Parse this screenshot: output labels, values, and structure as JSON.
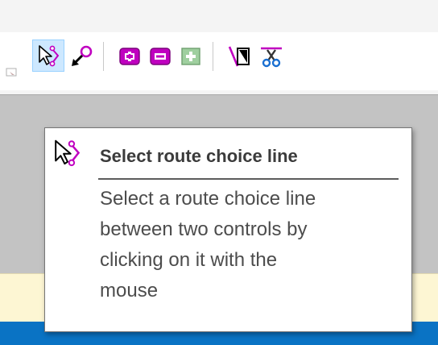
{
  "toolbar": {
    "buttons": [
      {
        "name": "select-route-choice-line",
        "icon": "select-route-choice-line-icon",
        "active": true
      },
      {
        "name": "move-control",
        "icon": "move-control-arrow-icon",
        "active": false
      },
      {
        "name": "add-control",
        "icon": "add-plus-icon",
        "active": false
      },
      {
        "name": "remove-control",
        "icon": "remove-minus-icon",
        "active": false
      },
      {
        "name": "add-control-disabled",
        "icon": "add-plus-green-icon",
        "active": false
      },
      {
        "name": "draw-line",
        "icon": "line-tool-icon",
        "active": false
      },
      {
        "name": "cut",
        "icon": "scissors-icon",
        "active": false
      }
    ]
  },
  "tooltip": {
    "title": "Select route choice line",
    "description_lines": [
      "Select a route choice line",
      "between two controls by",
      "clicking on it with the",
      "mouse"
    ]
  },
  "colors": {
    "accent_magenta": "#c000c0",
    "active_button_bg": "#cde8ff",
    "taskbar": "#0a73c4",
    "status_strip": "#fdf6d3"
  }
}
